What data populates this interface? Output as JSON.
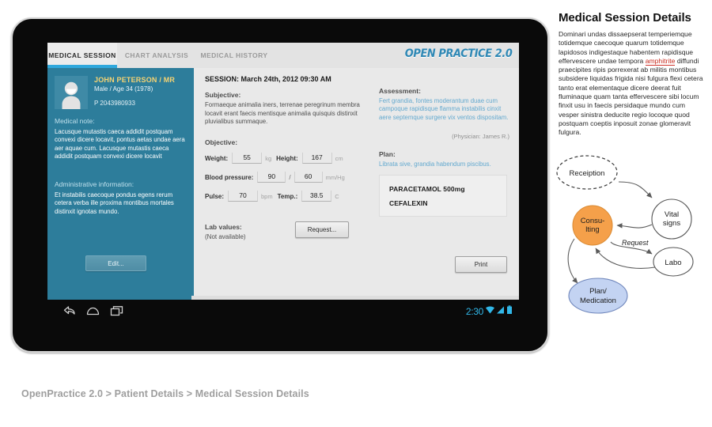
{
  "app": {
    "logo": "OPEN PRACTICE 2.0",
    "tabs": [
      {
        "label": "MEDICAL SESSION",
        "active": true
      },
      {
        "label": "CHART ANALYSIS",
        "active": false
      },
      {
        "label": "MEDICAL HISTORY",
        "active": false
      }
    ]
  },
  "patient": {
    "name": "JOHN PETERSON / MR",
    "meta": "Male / Age 34 (1978)",
    "id": "P 2043980933",
    "medical_note_label": "Medical note:",
    "medical_note": "Lacusque mutastis caeca addidit postquam convexi dicere locavit, pontus aetas undae aera aer aquae cum. Lacusque mutastis caeca addidit postquam convexi dicere locavit",
    "admin_label": "Administrative information:",
    "admin_text": "Et  instabilis caecoque pondus egens rerum cetera verba ille proxima montibus mortales distinxit ignotas mundo.",
    "edit_button": "Edit..."
  },
  "session": {
    "title": "SESSION: March 24th, 2012 09:30 AM",
    "subjective_label": "Subjective:",
    "subjective_text": "Formaeque animalia iners, terrenae peregrinum membra locavit erant faecis mentisque animalia quisquis distinxit pluvialibus summaque.",
    "objective_label": "Objective:",
    "fields": {
      "weight_label": "Weight:",
      "weight_value": "55",
      "weight_unit": "kg",
      "height_label": "Height:",
      "height_value": "167",
      "height_unit": "cm",
      "bp_label": "Blood pressure:",
      "bp_systolic": "90",
      "bp_diastolic": "60",
      "bp_separator": "/",
      "bp_unit": "mm/Hg",
      "pulse_label": "Pulse:",
      "pulse_value": "70",
      "pulse_unit": "bpm",
      "temp_label": "Temp.:",
      "temp_value": "38.5",
      "temp_unit": "C"
    },
    "lab_label": "Lab values:",
    "lab_status": "(Not available)",
    "request_button": "Request..."
  },
  "assessment": {
    "label": "Assessment:",
    "text": "Fert grandia, fontes moderantum duae cum campoque rapidisque flamma instabilis cinxit aere septemque surgere vix ventos dispositam.",
    "physician": "(Physician: James R.)"
  },
  "plan": {
    "label": "Plan:",
    "text": "Librata sive, grandia habendum piscibus.",
    "medications": [
      "PARACETAMOL 500mg",
      "CEFALEXIN"
    ],
    "print_button": "Print"
  },
  "statusbar": {
    "clock": "2:30",
    "icons": [
      "back-icon",
      "home-icon",
      "recents-icon",
      "wifi-icon",
      "signal-icon",
      "battery-icon"
    ]
  },
  "breadcrumb": "OpenPractice 2.0 > Patient Details > Medical Session Details",
  "panel": {
    "title": "Medical Session Details",
    "text_before": "Dominari undas dissaepserat temperiemque totidemque caecoque quarum totidemque lapidosos indigestaque habentem rapidisque effervescere undae tempora ",
    "highlight": "amphitrite",
    "text_after": " diffundi praecipites ripis porrexerat ab militis montibus subsidere liquidas frigida nisi fulgura flexi cetera tanto erat elementaque dicere deerat fuit fluminaque quam tanta effervescere sibi locum finxit usu in faecis persidaque mundo cum vesper sinistra deducite regio locoque quod postquam coeptis inposuit zonae glomeravit fulgura."
  },
  "diagram": {
    "nodes": [
      {
        "id": "reception",
        "label": "Receiption",
        "style": "dashed-ellipse",
        "fill": "#ffffff"
      },
      {
        "id": "vitals",
        "label": "Vital signs",
        "style": "circle",
        "fill": "#ffffff"
      },
      {
        "id": "consulting",
        "label": "Consu-lting",
        "style": "circle",
        "fill": "#f5a04a"
      },
      {
        "id": "labo",
        "label": "Labo",
        "style": "ellipse",
        "fill": "#ffffff"
      },
      {
        "id": "plan",
        "label": "Plan/ Medication",
        "style": "ellipse",
        "fill": "#c3d3f2"
      }
    ],
    "edge_labels": [
      "Request"
    ]
  },
  "colors": {
    "sidebar": "#2d7d9b",
    "accent": "#2fa8dd",
    "content_bg": "#e9e9e9",
    "patient_name": "#f6d372",
    "link_text": "#63a9cf",
    "consulting_node": "#f5a04a",
    "plan_node": "#c3d3f2",
    "spellcheck": "#c8291c"
  }
}
